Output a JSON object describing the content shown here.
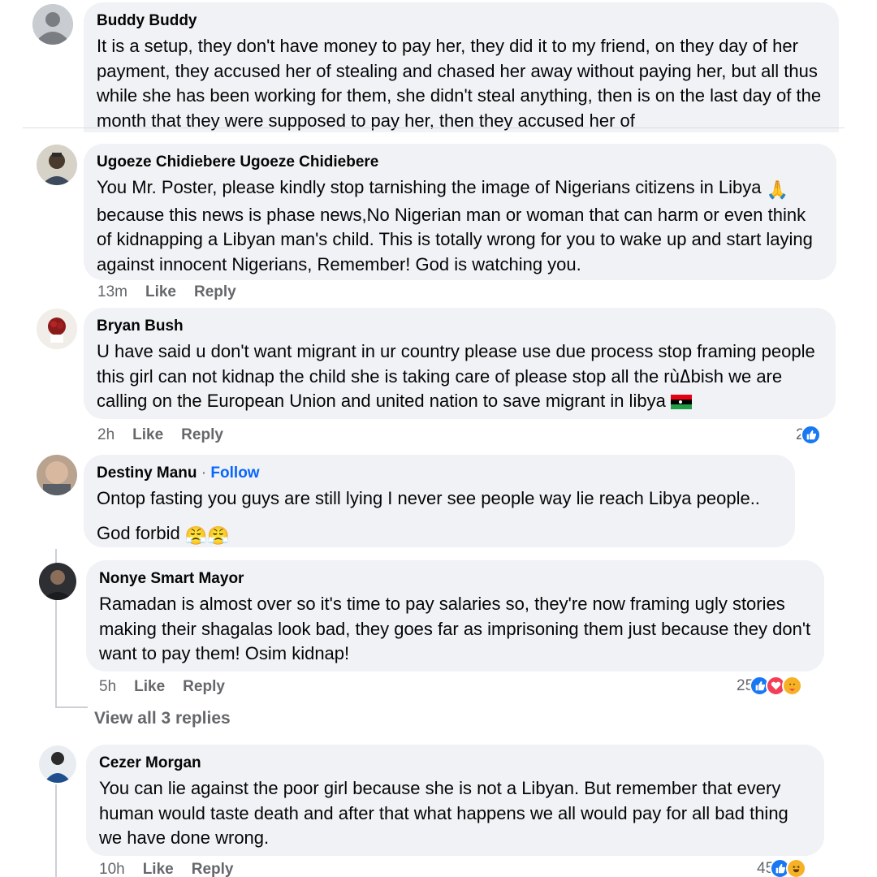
{
  "comments": [
    {
      "author": "Buddy Buddy",
      "text": "It is a setup, they don't have money to pay her, they did it to my friend, on they day of her payment, they accused her of stealing and chased her away without paying her, but all thus while she has been working for them, she didn't steal anything, then is on the last day of the month that they were supposed to pay her, then they accused her of"
    },
    {
      "author": "Ugoeze Chidiebere Ugoeze Chidiebere",
      "text": "You Mr. Poster, please kindly stop tarnishing the image of Nigerians citizens in Libya",
      "text_emoji": "🙏",
      "text_rest": "because this news is phase news,No Nigerian man or woman that can harm or even think of kidnapping a Libyan man's child. This is totally wrong for you to wake up and start laying against innocent Nigerians, Remember! God is watching you.",
      "time": "13m",
      "like": "Like",
      "reply": "Reply"
    },
    {
      "author": "Bryan Bush",
      "text": "U have said u don't want migrant in ur country please use due process stop framing people this girl can not kidnap the child she is taking care of please stop all the rùߡbish we are calling on the European Union and united nation to save migrant in libya",
      "time": "2h",
      "like": "Like",
      "reply": "Reply",
      "reaction_count": "2"
    },
    {
      "author": "Destiny Manu",
      "follow": "Follow",
      "separator": " · ",
      "text": "Ontop fasting you guys are still lying I never see people way lie reach Libya people..",
      "text2": "God forbid",
      "text2_emoji": "😤😤"
    },
    {
      "author": "Nonye Smart Mayor",
      "text": "Ramadan is almost over so it's time to pay salaries so, they're now framing ugly stories making their shagalas look bad, they goes far as imprisoning them just because they don't want to pay them! Osim kidnap!",
      "time": "5h",
      "like": "Like",
      "reply": "Reply",
      "reaction_count": "25"
    },
    {
      "view_replies": "View all 3 replies"
    },
    {
      "author": "Cezer Morgan",
      "text": "You can lie against the poor girl because she is not a Libyan. But remember that every human would taste death and after that what happens we all would pay for all bad thing we have done wrong.",
      "time": "10h",
      "like": "Like",
      "reply": "Reply",
      "reaction_count": "45"
    }
  ],
  "colors": {
    "bubble": "#f0f2f5",
    "meta": "#65676b",
    "link": "#0866ff",
    "like_blue": "#1877f2"
  }
}
